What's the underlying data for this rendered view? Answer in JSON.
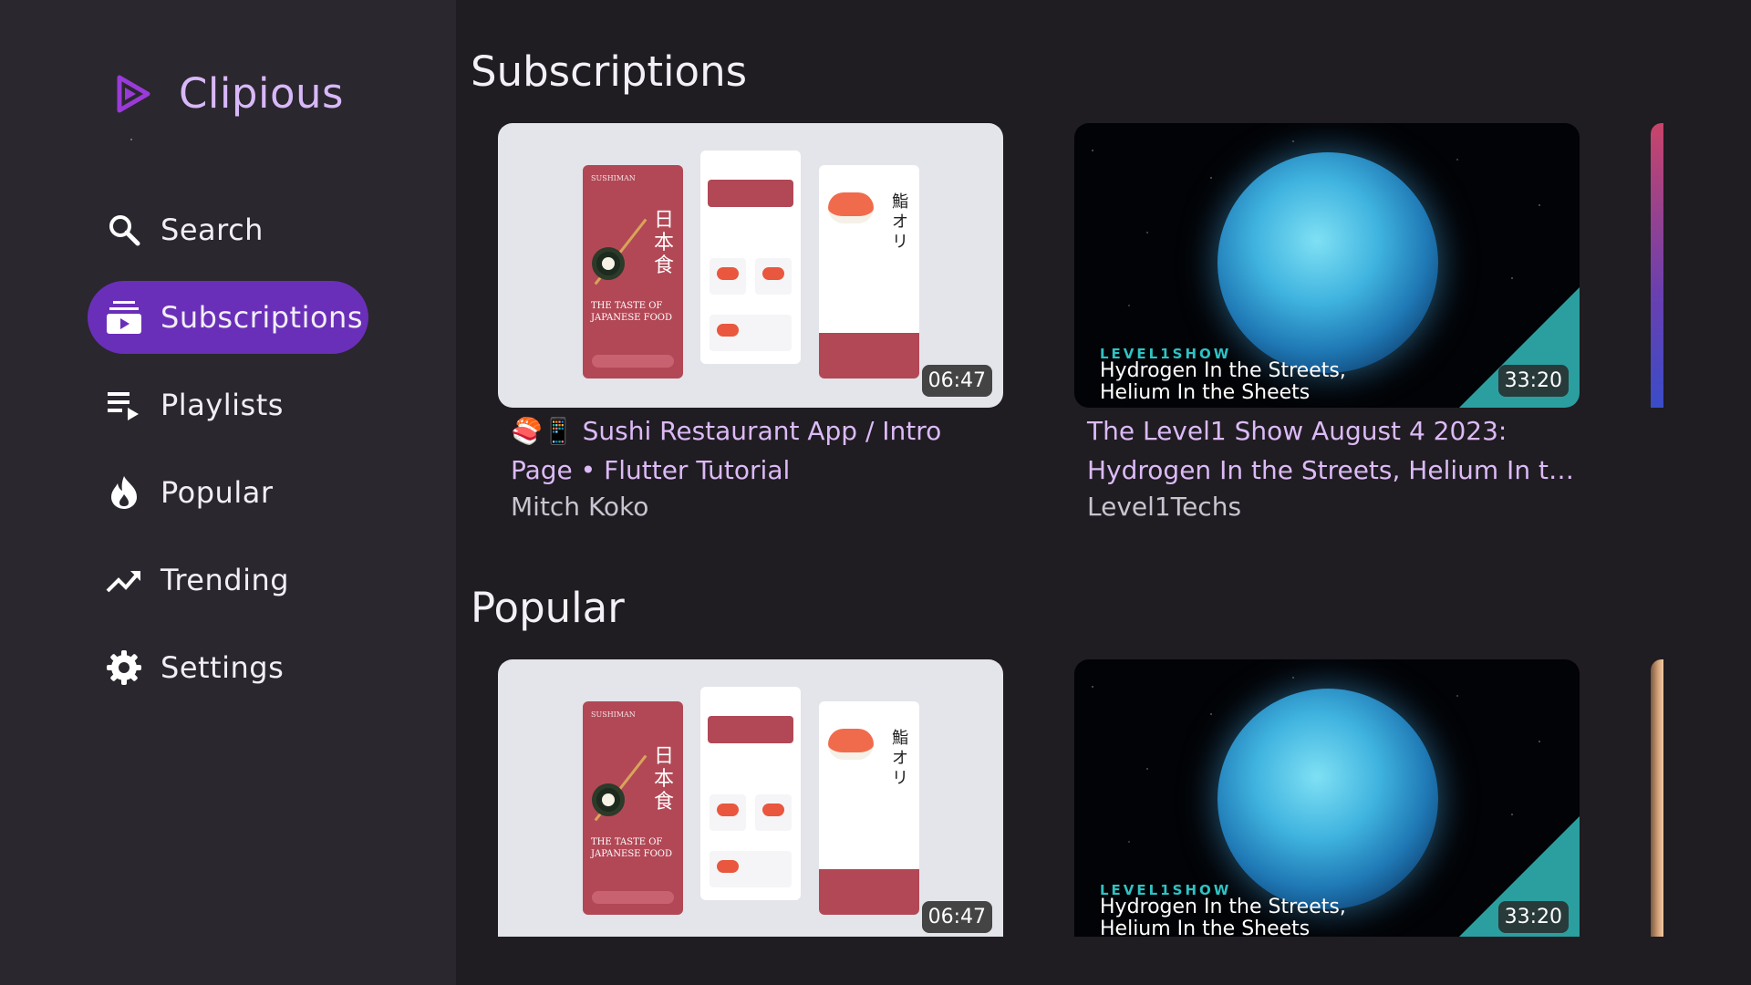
{
  "app": {
    "title": "Clipious"
  },
  "sidebar": {
    "items": [
      {
        "label": "Search",
        "icon": "search-icon",
        "active": false
      },
      {
        "label": "Subscriptions",
        "icon": "subscriptions-icon",
        "active": true
      },
      {
        "label": "Playlists",
        "icon": "playlist-icon",
        "active": false
      },
      {
        "label": "Popular",
        "icon": "fire-icon",
        "active": false
      },
      {
        "label": "Trending",
        "icon": "trending-icon",
        "active": false
      },
      {
        "label": "Settings",
        "icon": "gear-icon",
        "active": false
      }
    ]
  },
  "colors": {
    "accent": "#6a2fb8",
    "brand": "#d8b8f8",
    "title_text": "#dcbaf6",
    "background": "#1f1c22",
    "sidebar": "#2a272e"
  },
  "sections": [
    {
      "title": "Subscriptions",
      "videos": [
        {
          "title_line1": "🍣📱 Sushi Restaurant App / Intro",
          "title_line2": "Page • Flutter Tutorial",
          "channel": "Mitch Koko",
          "duration": "06:47",
          "thumb": {
            "brand": "SUSHIMAN",
            "japanese_vertical": "日本食",
            "tagline_1": "THE TASTE OF",
            "tagline_2": "JAPANESE FOOD",
            "detail_japanese": "鮨オリ"
          }
        },
        {
          "title_line1": "The Level1 Show August 4 2023:",
          "title_line2": "Hydrogen In the Streets, Helium In the…",
          "channel": "Level1Techs",
          "duration": "33:20",
          "thumb": {
            "logo": "LEVEL1SHOW",
            "line1": "Hydrogen In the Streets,",
            "line2": "Helium In the Sheets"
          }
        }
      ]
    },
    {
      "title": "Popular",
      "videos": [
        {
          "duration": "06:47",
          "thumb": {
            "brand": "SUSHIMAN",
            "japanese_vertical": "日本食",
            "tagline_1": "THE TASTE OF",
            "tagline_2": "JAPANESE FOOD",
            "detail_japanese": "鮨オリ"
          }
        },
        {
          "duration": "33:20",
          "thumb": {
            "logo": "LEVEL1SHOW",
            "line1": "Hydrogen In the Streets,",
            "line2": "Helium In the Sheets"
          }
        }
      ]
    }
  ]
}
